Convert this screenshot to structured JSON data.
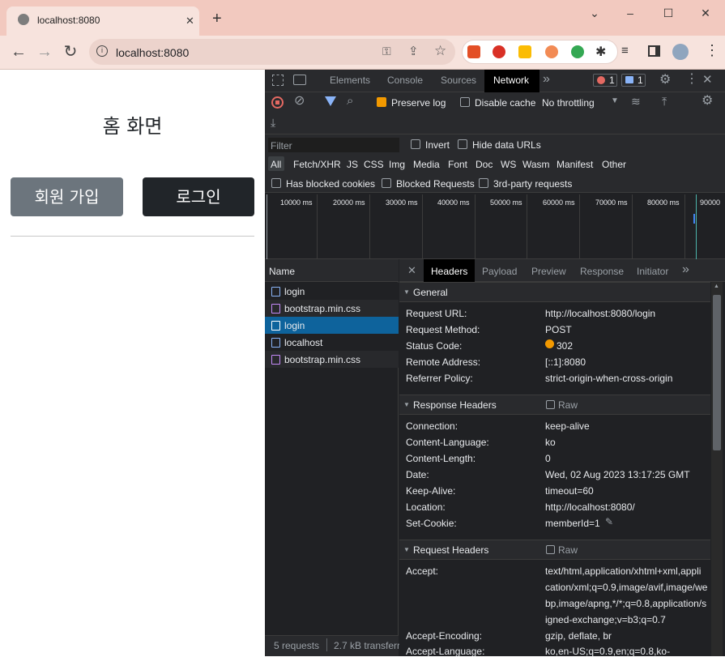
{
  "browser": {
    "tab_title": "localhost:8080",
    "tab_close": "✕",
    "new_tab": "+",
    "url": "localhost:8080",
    "window_controls": [
      "⌄",
      "–",
      "☐",
      "✕"
    ]
  },
  "page": {
    "title": "홈 화면",
    "signup_label": "회원 가입",
    "login_label": "로그인"
  },
  "devtools": {
    "tabs": [
      "Elements",
      "Console",
      "Sources",
      "Network"
    ],
    "active_tab": "Network",
    "more_tabs": "»",
    "error_count": "1",
    "message_count": "1",
    "toolbar": {
      "preserve_log": "Preserve log",
      "disable_cache": "Disable cache",
      "throttling": "No throttling"
    },
    "filter": {
      "placeholder": "Filter",
      "invert": "Invert",
      "hide_data_urls": "Hide data URLs",
      "types": [
        "All",
        "Fetch/XHR",
        "JS",
        "CSS",
        "Img",
        "Media",
        "Font",
        "Doc",
        "WS",
        "Wasm",
        "Manifest",
        "Other"
      ],
      "has_blocked_cookies": "Has blocked cookies",
      "blocked_requests": "Blocked Requests",
      "third_party": "3rd-party requests"
    },
    "timeline_ticks": [
      "10000 ms",
      "20000 ms",
      "30000 ms",
      "40000 ms",
      "50000 ms",
      "60000 ms",
      "70000 ms",
      "80000 ms",
      "90000"
    ],
    "list": {
      "header": "Name",
      "requests": [
        {
          "name": "login",
          "type": "doc"
        },
        {
          "name": "bootstrap.min.css",
          "type": "css"
        },
        {
          "name": "login",
          "type": "doc",
          "selected": true
        },
        {
          "name": "localhost",
          "type": "doc"
        },
        {
          "name": "bootstrap.min.css",
          "type": "css"
        }
      ],
      "footer_requests": "5 requests",
      "footer_transferred": "2.7 kB transferr"
    },
    "detail_tabs": [
      "Headers",
      "Payload",
      "Preview",
      "Response",
      "Initiator"
    ],
    "detail_close": "✕",
    "general": {
      "title": "General",
      "rows": [
        {
          "name": "Request URL:",
          "value": "http://localhost:8080/login"
        },
        {
          "name": "Request Method:",
          "value": "POST"
        },
        {
          "name": "Status Code:",
          "value": "302"
        },
        {
          "name": "Remote Address:",
          "value": "[::1]:8080"
        },
        {
          "name": "Referrer Policy:",
          "value": "strict-origin-when-cross-origin"
        }
      ]
    },
    "response_headers": {
      "title": "Response Headers",
      "raw": "Raw",
      "rows": [
        {
          "name": "Connection:",
          "value": "keep-alive"
        },
        {
          "name": "Content-Language:",
          "value": "ko"
        },
        {
          "name": "Content-Length:",
          "value": "0"
        },
        {
          "name": "Date:",
          "value": "Wed, 02 Aug 2023 13:17:25 GMT"
        },
        {
          "name": "Keep-Alive:",
          "value": "timeout=60"
        },
        {
          "name": "Location:",
          "value": "http://localhost:8080/"
        },
        {
          "name": "Set-Cookie:",
          "value": "memberId=1"
        }
      ]
    },
    "request_headers": {
      "title": "Request Headers",
      "raw": "Raw",
      "accept_name": "Accept:",
      "accept_lines": [
        "text/html,application/xhtml+xml,appli",
        "cation/xml;q=0.9,image/avif,image/we",
        "bp,image/apng,*/*;q=0.8,application/s",
        "igned-exchange;v=b3;q=0.7"
      ],
      "accept_encoding_name": "Accept-Encoding:",
      "accept_encoding_value": "gzip, deflate, br",
      "accept_language_name": "Accept-Language:",
      "accept_language_value": "ko,en-US;q=0.9,en;q=0.8,ko-"
    }
  }
}
